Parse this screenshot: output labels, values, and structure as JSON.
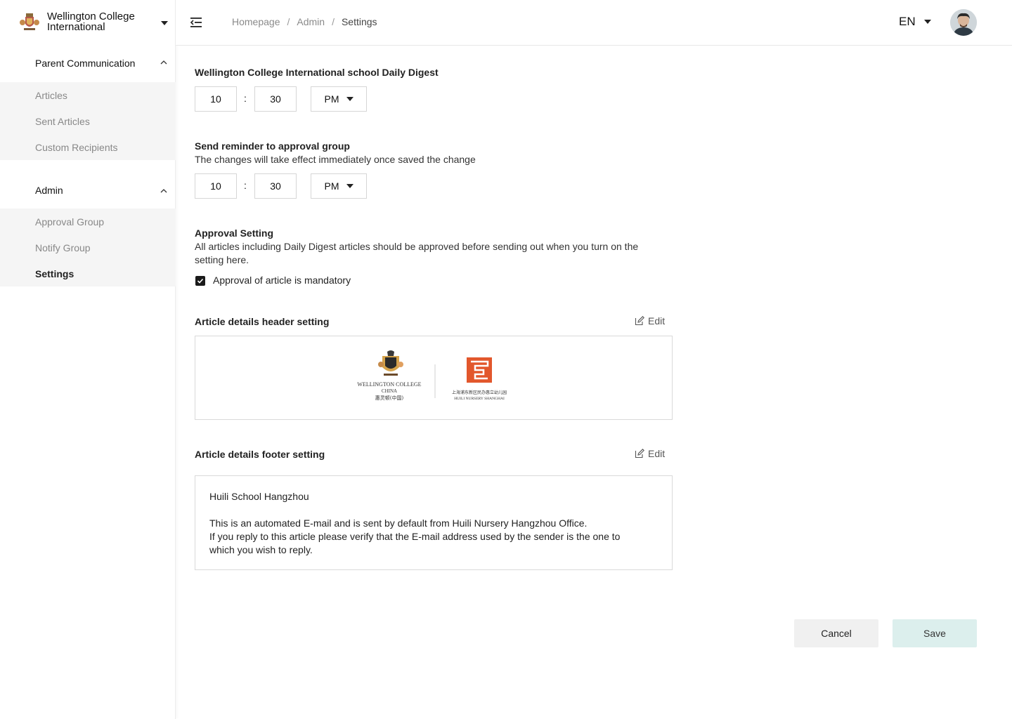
{
  "brand": {
    "name": "Wellington College International"
  },
  "sidebar": {
    "sections": [
      {
        "label": "Parent Communication",
        "items": [
          "Articles",
          "Sent Articles",
          "Custom Recipients"
        ]
      },
      {
        "label": "Admin",
        "items": [
          "Approval Group",
          "Notify Group",
          "Settings"
        ]
      }
    ],
    "active_item": "Settings"
  },
  "header": {
    "breadcrumb": [
      "Homepage",
      "Admin",
      "Settings"
    ],
    "language": "EN"
  },
  "digest": {
    "title": "Wellington College International school Daily Digest",
    "hour": "10",
    "minute": "30",
    "period": "PM"
  },
  "reminder": {
    "title": "Send reminder to approval group",
    "description": "The changes will take effect immediately once saved the change",
    "hour": "10",
    "minute": "30",
    "period": "PM"
  },
  "approval": {
    "title": "Approval Setting",
    "description": "All articles including Daily Digest articles should be approved before sending out when you turn on the setting here.",
    "checkbox_label": "Approval of article is mandatory",
    "checked": true
  },
  "header_setting": {
    "title": "Article details header setting",
    "edit_label": "Edit",
    "logo_left": {
      "line1": "WELLINGTON COLLEGE",
      "line2": "CHINA",
      "line3": "惠灵顿(中国)"
    },
    "logo_right": {
      "line1": "上海浦东新区民办惠立幼儿园",
      "line2": "HUILI NURSERY SHANGHAI"
    }
  },
  "footer_setting": {
    "title": "Article details footer setting",
    "edit_label": "Edit",
    "school": "Huili School Hangzhou",
    "line1": "This is an automated E-mail and is sent by default from Huili Nursery Hangzhou Office.",
    "line2": "If you reply to this article please verify that the E-mail address used by the sender is the one to which you wish to reply."
  },
  "actions": {
    "cancel": "Cancel",
    "save": "Save"
  },
  "colors": {
    "save_bg": "#dcefed",
    "cancel_bg": "#f0f0f0",
    "logo_red": "#e2572c"
  }
}
